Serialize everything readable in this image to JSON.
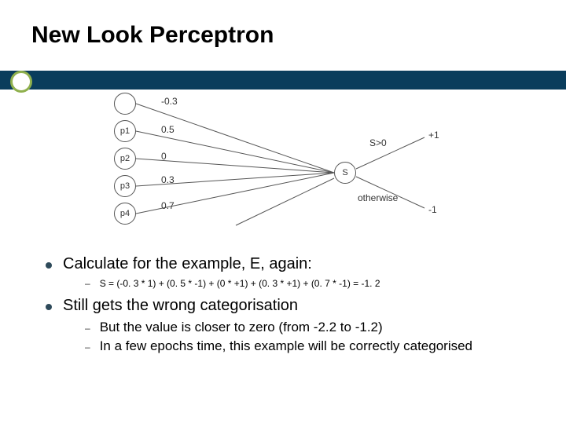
{
  "title": "New Look Perceptron",
  "diagram": {
    "nodes": {
      "p1": "p1",
      "p2": "p2",
      "p3": "p3",
      "p4": "p4",
      "s": "S"
    },
    "weights": {
      "w0": "-0.3",
      "w1": "0.5",
      "w2": "0",
      "w3": "0.3",
      "w4": "0.7"
    },
    "out": {
      "top_cond": "S>0",
      "top_val": "+1",
      "bot_cond": "otherwise",
      "bot_val": "-1"
    }
  },
  "bullets": {
    "a": "Calculate for the example, E, again:",
    "a1": "S = (-0. 3 * 1) + (0. 5 * -1) + (0 * +1) + (0. 3 * +1) + (0. 7 * -1) = -1. 2",
    "b": "Still gets the wrong categorisation",
    "b1": "But the value is closer to zero (from -2.2 to -1.2)",
    "b2": "In a few epochs time, this example will be correctly categorised"
  }
}
